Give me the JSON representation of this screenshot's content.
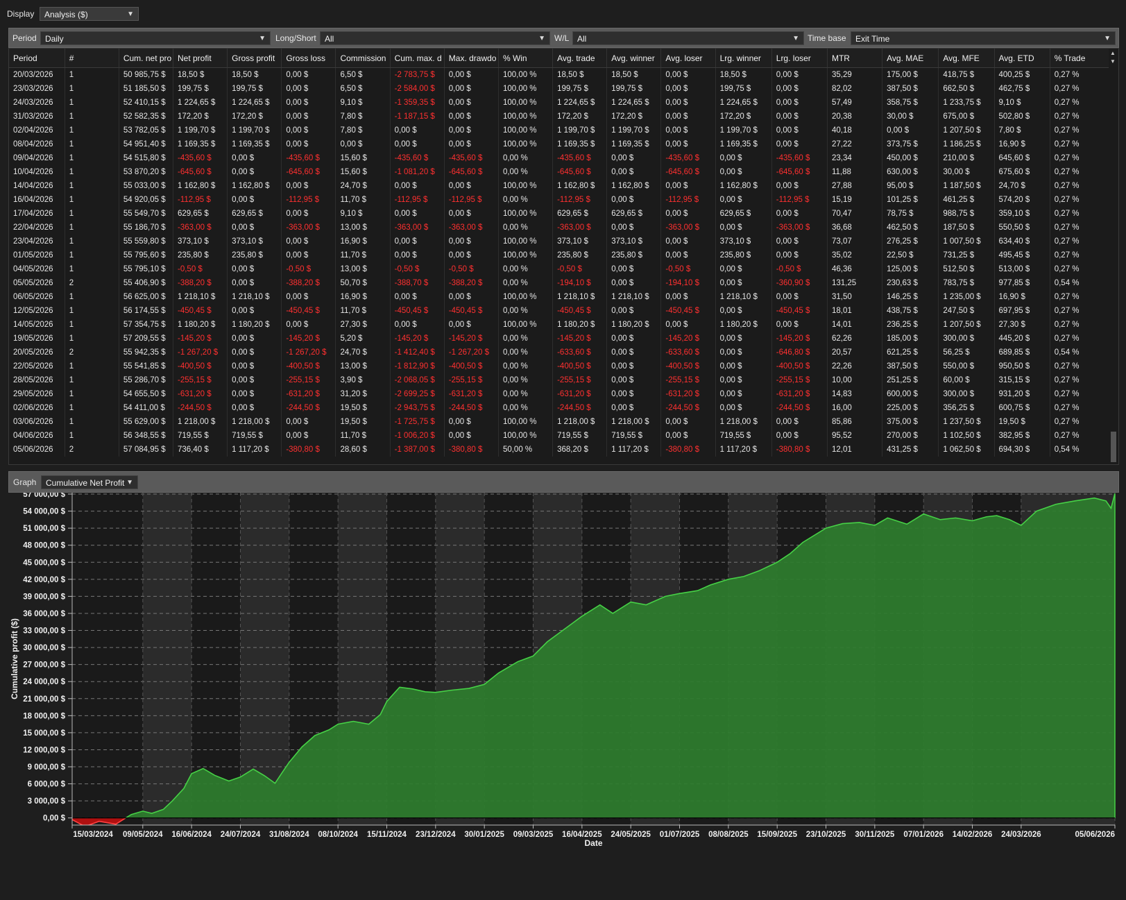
{
  "display": {
    "label": "Display",
    "value": "Analysis ($)"
  },
  "filters": [
    {
      "label": "Period",
      "value": "Daily"
    },
    {
      "label": "Long/Short",
      "value": "All"
    },
    {
      "label": "W/L",
      "value": "All"
    },
    {
      "label": "Time base",
      "value": "Exit Time"
    }
  ],
  "table": {
    "headers": [
      "Period",
      "#",
      "Cum. net pro",
      "Net profit",
      "Gross profit",
      "Gross loss",
      "Commission",
      "Cum. max. d",
      "Max. drawdo",
      "% Win",
      "Avg. trade",
      "Avg. winner",
      "Avg. loser",
      "Lrg. winner",
      "Lrg. loser",
      "MTR",
      "Avg. MAE",
      "Avg. MFE",
      "Avg. ETD",
      "% Trade"
    ],
    "rows": [
      [
        "20/03/2026",
        "1",
        "50 985,75 $",
        "18,50 $",
        "18,50 $",
        "0,00 $",
        "6,50 $",
        "-2 783,75 $",
        "0,00 $",
        "100,00 %",
        "18,50 $",
        "18,50 $",
        "0,00 $",
        "18,50 $",
        "0,00 $",
        "35,29",
        "175,00 $",
        "418,75 $",
        "400,25 $",
        "0,27 %"
      ],
      [
        "23/03/2026",
        "1",
        "51 185,50 $",
        "199,75 $",
        "199,75 $",
        "0,00 $",
        "6,50 $",
        "-2 584,00 $",
        "0,00 $",
        "100,00 %",
        "199,75 $",
        "199,75 $",
        "0,00 $",
        "199,75 $",
        "0,00 $",
        "82,02",
        "387,50 $",
        "662,50 $",
        "462,75 $",
        "0,27 %"
      ],
      [
        "24/03/2026",
        "1",
        "52 410,15 $",
        "1 224,65 $",
        "1 224,65 $",
        "0,00 $",
        "9,10 $",
        "-1 359,35 $",
        "0,00 $",
        "100,00 %",
        "1 224,65 $",
        "1 224,65 $",
        "0,00 $",
        "1 224,65 $",
        "0,00 $",
        "57,49",
        "358,75 $",
        "1 233,75 $",
        "9,10 $",
        "0,27 %"
      ],
      [
        "31/03/2026",
        "1",
        "52 582,35 $",
        "172,20 $",
        "172,20 $",
        "0,00 $",
        "7,80 $",
        "-1 187,15 $",
        "0,00 $",
        "100,00 %",
        "172,20 $",
        "172,20 $",
        "0,00 $",
        "172,20 $",
        "0,00 $",
        "20,38",
        "30,00 $",
        "675,00 $",
        "502,80 $",
        "0,27 %"
      ],
      [
        "02/04/2026",
        "1",
        "53 782,05 $",
        "1 199,70 $",
        "1 199,70 $",
        "0,00 $",
        "7,80 $",
        "0,00 $",
        "0,00 $",
        "100,00 %",
        "1 199,70 $",
        "1 199,70 $",
        "0,00 $",
        "1 199,70 $",
        "0,00 $",
        "40,18",
        "0,00 $",
        "1 207,50 $",
        "7,80 $",
        "0,27 %"
      ],
      [
        "08/04/2026",
        "1",
        "54 951,40 $",
        "1 169,35 $",
        "1 169,35 $",
        "0,00 $",
        "0,00 $",
        "0,00 $",
        "0,00 $",
        "100,00 %",
        "1 169,35 $",
        "1 169,35 $",
        "0,00 $",
        "1 169,35 $",
        "0,00 $",
        "27,22",
        "373,75 $",
        "1 186,25 $",
        "16,90 $",
        "0,27 %"
      ],
      [
        "09/04/2026",
        "1",
        "54 515,80 $",
        "-435,60 $",
        "0,00 $",
        "-435,60 $",
        "15,60 $",
        "-435,60 $",
        "-435,60 $",
        "0,00 %",
        "-435,60 $",
        "0,00 $",
        "-435,60 $",
        "0,00 $",
        "-435,60 $",
        "23,34",
        "450,00 $",
        "210,00 $",
        "645,60 $",
        "0,27 %"
      ],
      [
        "10/04/2026",
        "1",
        "53 870,20 $",
        "-645,60 $",
        "0,00 $",
        "-645,60 $",
        "15,60 $",
        "-1 081,20 $",
        "-645,60 $",
        "0,00 %",
        "-645,60 $",
        "0,00 $",
        "-645,60 $",
        "0,00 $",
        "-645,60 $",
        "11,88",
        "630,00 $",
        "30,00 $",
        "675,60 $",
        "0,27 %"
      ],
      [
        "14/04/2026",
        "1",
        "55 033,00 $",
        "1 162,80 $",
        "1 162,80 $",
        "0,00 $",
        "24,70 $",
        "0,00 $",
        "0,00 $",
        "100,00 %",
        "1 162,80 $",
        "1 162,80 $",
        "0,00 $",
        "1 162,80 $",
        "0,00 $",
        "27,88",
        "95,00 $",
        "1 187,50 $",
        "24,70 $",
        "0,27 %"
      ],
      [
        "16/04/2026",
        "1",
        "54 920,05 $",
        "-112,95 $",
        "0,00 $",
        "-112,95 $",
        "11,70 $",
        "-112,95 $",
        "-112,95 $",
        "0,00 %",
        "-112,95 $",
        "0,00 $",
        "-112,95 $",
        "0,00 $",
        "-112,95 $",
        "15,19",
        "101,25 $",
        "461,25 $",
        "574,20 $",
        "0,27 %"
      ],
      [
        "17/04/2026",
        "1",
        "55 549,70 $",
        "629,65 $",
        "629,65 $",
        "0,00 $",
        "9,10 $",
        "0,00 $",
        "0,00 $",
        "100,00 %",
        "629,65 $",
        "629,65 $",
        "0,00 $",
        "629,65 $",
        "0,00 $",
        "70,47",
        "78,75 $",
        "988,75 $",
        "359,10 $",
        "0,27 %"
      ],
      [
        "22/04/2026",
        "1",
        "55 186,70 $",
        "-363,00 $",
        "0,00 $",
        "-363,00 $",
        "13,00 $",
        "-363,00 $",
        "-363,00 $",
        "0,00 %",
        "-363,00 $",
        "0,00 $",
        "-363,00 $",
        "0,00 $",
        "-363,00 $",
        "36,68",
        "462,50 $",
        "187,50 $",
        "550,50 $",
        "0,27 %"
      ],
      [
        "23/04/2026",
        "1",
        "55 559,80 $",
        "373,10 $",
        "373,10 $",
        "0,00 $",
        "16,90 $",
        "0,00 $",
        "0,00 $",
        "100,00 %",
        "373,10 $",
        "373,10 $",
        "0,00 $",
        "373,10 $",
        "0,00 $",
        "73,07",
        "276,25 $",
        "1 007,50 $",
        "634,40 $",
        "0,27 %"
      ],
      [
        "01/05/2026",
        "1",
        "55 795,60 $",
        "235,80 $",
        "235,80 $",
        "0,00 $",
        "11,70 $",
        "0,00 $",
        "0,00 $",
        "100,00 %",
        "235,80 $",
        "235,80 $",
        "0,00 $",
        "235,80 $",
        "0,00 $",
        "35,02",
        "22,50 $",
        "731,25 $",
        "495,45 $",
        "0,27 %"
      ],
      [
        "04/05/2026",
        "1",
        "55 795,10 $",
        "-0,50 $",
        "0,00 $",
        "-0,50 $",
        "13,00 $",
        "-0,50 $",
        "-0,50 $",
        "0,00 %",
        "-0,50 $",
        "0,00 $",
        "-0,50 $",
        "0,00 $",
        "-0,50 $",
        "46,36",
        "125,00 $",
        "512,50 $",
        "513,00 $",
        "0,27 %"
      ],
      [
        "05/05/2026",
        "2",
        "55 406,90 $",
        "-388,20 $",
        "0,00 $",
        "-388,20 $",
        "50,70 $",
        "-388,70 $",
        "-388,20 $",
        "0,00 %",
        "-194,10 $",
        "0,00 $",
        "-194,10 $",
        "0,00 $",
        "-360,90 $",
        "131,25",
        "230,63 $",
        "783,75 $",
        "977,85 $",
        "0,54 %"
      ],
      [
        "06/05/2026",
        "1",
        "56 625,00 $",
        "1 218,10 $",
        "1 218,10 $",
        "0,00 $",
        "16,90 $",
        "0,00 $",
        "0,00 $",
        "100,00 %",
        "1 218,10 $",
        "1 218,10 $",
        "0,00 $",
        "1 218,10 $",
        "0,00 $",
        "31,50",
        "146,25 $",
        "1 235,00 $",
        "16,90 $",
        "0,27 %"
      ],
      [
        "12/05/2026",
        "1",
        "56 174,55 $",
        "-450,45 $",
        "0,00 $",
        "-450,45 $",
        "11,70 $",
        "-450,45 $",
        "-450,45 $",
        "0,00 %",
        "-450,45 $",
        "0,00 $",
        "-450,45 $",
        "0,00 $",
        "-450,45 $",
        "18,01",
        "438,75 $",
        "247,50 $",
        "697,95 $",
        "0,27 %"
      ],
      [
        "14/05/2026",
        "1",
        "57 354,75 $",
        "1 180,20 $",
        "1 180,20 $",
        "0,00 $",
        "27,30 $",
        "0,00 $",
        "0,00 $",
        "100,00 %",
        "1 180,20 $",
        "1 180,20 $",
        "0,00 $",
        "1 180,20 $",
        "0,00 $",
        "14,01",
        "236,25 $",
        "1 207,50 $",
        "27,30 $",
        "0,27 %"
      ],
      [
        "19/05/2026",
        "1",
        "57 209,55 $",
        "-145,20 $",
        "0,00 $",
        "-145,20 $",
        "5,20 $",
        "-145,20 $",
        "-145,20 $",
        "0,00 %",
        "-145,20 $",
        "0,00 $",
        "-145,20 $",
        "0,00 $",
        "-145,20 $",
        "62,26",
        "185,00 $",
        "300,00 $",
        "445,20 $",
        "0,27 %"
      ],
      [
        "20/05/2026",
        "2",
        "55 942,35 $",
        "-1 267,20 $",
        "0,00 $",
        "-1 267,20 $",
        "24,70 $",
        "-1 412,40 $",
        "-1 267,20 $",
        "0,00 %",
        "-633,60 $",
        "0,00 $",
        "-633,60 $",
        "0,00 $",
        "-646,80 $",
        "20,57",
        "621,25 $",
        "56,25 $",
        "689,85 $",
        "0,54 %"
      ],
      [
        "22/05/2026",
        "1",
        "55 541,85 $",
        "-400,50 $",
        "0,00 $",
        "-400,50 $",
        "13,00 $",
        "-1 812,90 $",
        "-400,50 $",
        "0,00 %",
        "-400,50 $",
        "0,00 $",
        "-400,50 $",
        "0,00 $",
        "-400,50 $",
        "22,26",
        "387,50 $",
        "550,00 $",
        "950,50 $",
        "0,27 %"
      ],
      [
        "28/05/2026",
        "1",
        "55 286,70 $",
        "-255,15 $",
        "0,00 $",
        "-255,15 $",
        "3,90 $",
        "-2 068,05 $",
        "-255,15 $",
        "0,00 %",
        "-255,15 $",
        "0,00 $",
        "-255,15 $",
        "0,00 $",
        "-255,15 $",
        "10,00",
        "251,25 $",
        "60,00 $",
        "315,15 $",
        "0,27 %"
      ],
      [
        "29/05/2026",
        "1",
        "54 655,50 $",
        "-631,20 $",
        "0,00 $",
        "-631,20 $",
        "31,20 $",
        "-2 699,25 $",
        "-631,20 $",
        "0,00 %",
        "-631,20 $",
        "0,00 $",
        "-631,20 $",
        "0,00 $",
        "-631,20 $",
        "14,83",
        "600,00 $",
        "300,00 $",
        "931,20 $",
        "0,27 %"
      ],
      [
        "02/06/2026",
        "1",
        "54 411,00 $",
        "-244,50 $",
        "0,00 $",
        "-244,50 $",
        "19,50 $",
        "-2 943,75 $",
        "-244,50 $",
        "0,00 %",
        "-244,50 $",
        "0,00 $",
        "-244,50 $",
        "0,00 $",
        "-244,50 $",
        "16,00",
        "225,00 $",
        "356,25 $",
        "600,75 $",
        "0,27 %"
      ],
      [
        "03/06/2026",
        "1",
        "55 629,00 $",
        "1 218,00 $",
        "1 218,00 $",
        "0,00 $",
        "19,50 $",
        "-1 725,75 $",
        "0,00 $",
        "100,00 %",
        "1 218,00 $",
        "1 218,00 $",
        "0,00 $",
        "1 218,00 $",
        "0,00 $",
        "85,86",
        "375,00 $",
        "1 237,50 $",
        "19,50 $",
        "0,27 %"
      ],
      [
        "04/06/2026",
        "1",
        "56 348,55 $",
        "719,55 $",
        "719,55 $",
        "0,00 $",
        "11,70 $",
        "-1 006,20 $",
        "0,00 $",
        "100,00 %",
        "719,55 $",
        "719,55 $",
        "0,00 $",
        "719,55 $",
        "0,00 $",
        "95,52",
        "270,00 $",
        "1 102,50 $",
        "382,95 $",
        "0,27 %"
      ],
      [
        "05/06/2026",
        "2",
        "57 084,95 $",
        "736,40 $",
        "1 117,20 $",
        "-380,80 $",
        "28,60 $",
        "-1 387,00 $",
        "-380,80 $",
        "50,00 %",
        "368,20 $",
        "1 117,20 $",
        "-380,80 $",
        "1 117,20 $",
        "-380,80 $",
        "12,01",
        "431,25 $",
        "1 062,50 $",
        "694,30 $",
        "0,54 %"
      ]
    ]
  },
  "graph": {
    "label": "Graph",
    "value": "Cumulative Net Profit"
  },
  "colors": {
    "positive_fill": "#2e7d2e",
    "positive_line": "#46d146",
    "negative_fill": "#b01010",
    "negative_text": "#ff3030"
  },
  "chart_data": {
    "type": "area",
    "xlabel": "Date",
    "ylabel": "Cumulative profit ($)",
    "ylim": [
      -1500,
      57000
    ],
    "yticks": [
      "0,00 $",
      "3 000,00 $",
      "6 000,00 $",
      "9 000,00 $",
      "12 000,00 $",
      "15 000,00 $",
      "18 000,00 $",
      "21 000,00 $",
      "24 000,00 $",
      "27 000,00 $",
      "30 000,00 $",
      "33 000,00 $",
      "36 000,00 $",
      "39 000,00 $",
      "42 000,00 $",
      "45 000,00 $",
      "48 000,00 $",
      "51 000,00 $",
      "54 000,00 $",
      "57 000,00 $"
    ],
    "xticks": [
      "15/03/2024",
      "09/05/2024",
      "16/06/2024",
      "24/07/2024",
      "31/08/2024",
      "08/10/2024",
      "15/11/2024",
      "23/12/2024",
      "30/01/2025",
      "09/03/2025",
      "16/04/2025",
      "24/05/2025",
      "01/07/2025",
      "08/08/2025",
      "15/09/2025",
      "23/10/2025",
      "30/11/2025",
      "07/01/2026",
      "14/02/2026",
      "24/03/2026",
      "05/06/2026"
    ],
    "grid": true,
    "series": [
      {
        "x": [
          "15/03/2024",
          "25/03/2024",
          "05/04/2024",
          "18/04/2024",
          "30/04/2024",
          "09/05/2024",
          "16/05/2024",
          "25/05/2024",
          "01/06/2024",
          "10/06/2024",
          "16/06/2024",
          "25/06/2024",
          "04/07/2024",
          "15/07/2024",
          "24/07/2024",
          "03/08/2024",
          "12/08/2024",
          "20/08/2024",
          "25/08/2024",
          "31/08/2024",
          "10/09/2024",
          "20/09/2024",
          "01/10/2024",
          "08/10/2024",
          "20/10/2024",
          "01/11/2024",
          "10/11/2024",
          "15/11/2024",
          "25/11/2024",
          "05/12/2024",
          "15/12/2024",
          "23/12/2024",
          "05/01/2025",
          "18/01/2025",
          "30/01/2025",
          "10/02/2025",
          "25/02/2025",
          "09/03/2025",
          "20/03/2025",
          "01/04/2025",
          "10/04/2025",
          "16/04/2025",
          "30/04/2025",
          "10/05/2025",
          "24/05/2025",
          "05/06/2025",
          "20/06/2025",
          "01/07/2025",
          "15/07/2025",
          "25/07/2025",
          "08/08/2025",
          "20/08/2025",
          "01/09/2025",
          "15/09/2025",
          "25/09/2025",
          "05/10/2025",
          "23/10/2025",
          "05/11/2025",
          "18/11/2025",
          "30/11/2025",
          "10/12/2025",
          "25/12/2025",
          "07/01/2026",
          "20/01/2026",
          "01/02/2026",
          "14/02/2026",
          "25/02/2026",
          "05/03/2026",
          "15/03/2026",
          "24/03/2026",
          "05/04/2026",
          "20/04/2026",
          "05/05/2026",
          "20/05/2026",
          "29/05/2026",
          "02/06/2026",
          "05/06/2026"
        ],
        "values": [
          -300,
          -1500,
          -600,
          -1100,
          600,
          1200,
          800,
          1500,
          3000,
          5200,
          7800,
          8700,
          7500,
          6500,
          7200,
          8600,
          7400,
          6100,
          7800,
          9800,
          12500,
          14500,
          15500,
          16500,
          17000,
          16500,
          18200,
          20500,
          23000,
          22700,
          22200,
          22100,
          22500,
          22800,
          23500,
          25500,
          27500,
          28500,
          31000,
          33000,
          34500,
          35500,
          37500,
          36000,
          38000,
          37500,
          39000,
          39500,
          40000,
          41000,
          42000,
          42500,
          43500,
          45000,
          46500,
          48500,
          51000,
          51800,
          52000,
          51500,
          52800,
          51700,
          53500,
          52500,
          52800,
          52300,
          53000,
          53200,
          52500,
          51500,
          54000,
          55200,
          55800,
          56300,
          55800,
          54500,
          57084.95
        ]
      }
    ]
  }
}
